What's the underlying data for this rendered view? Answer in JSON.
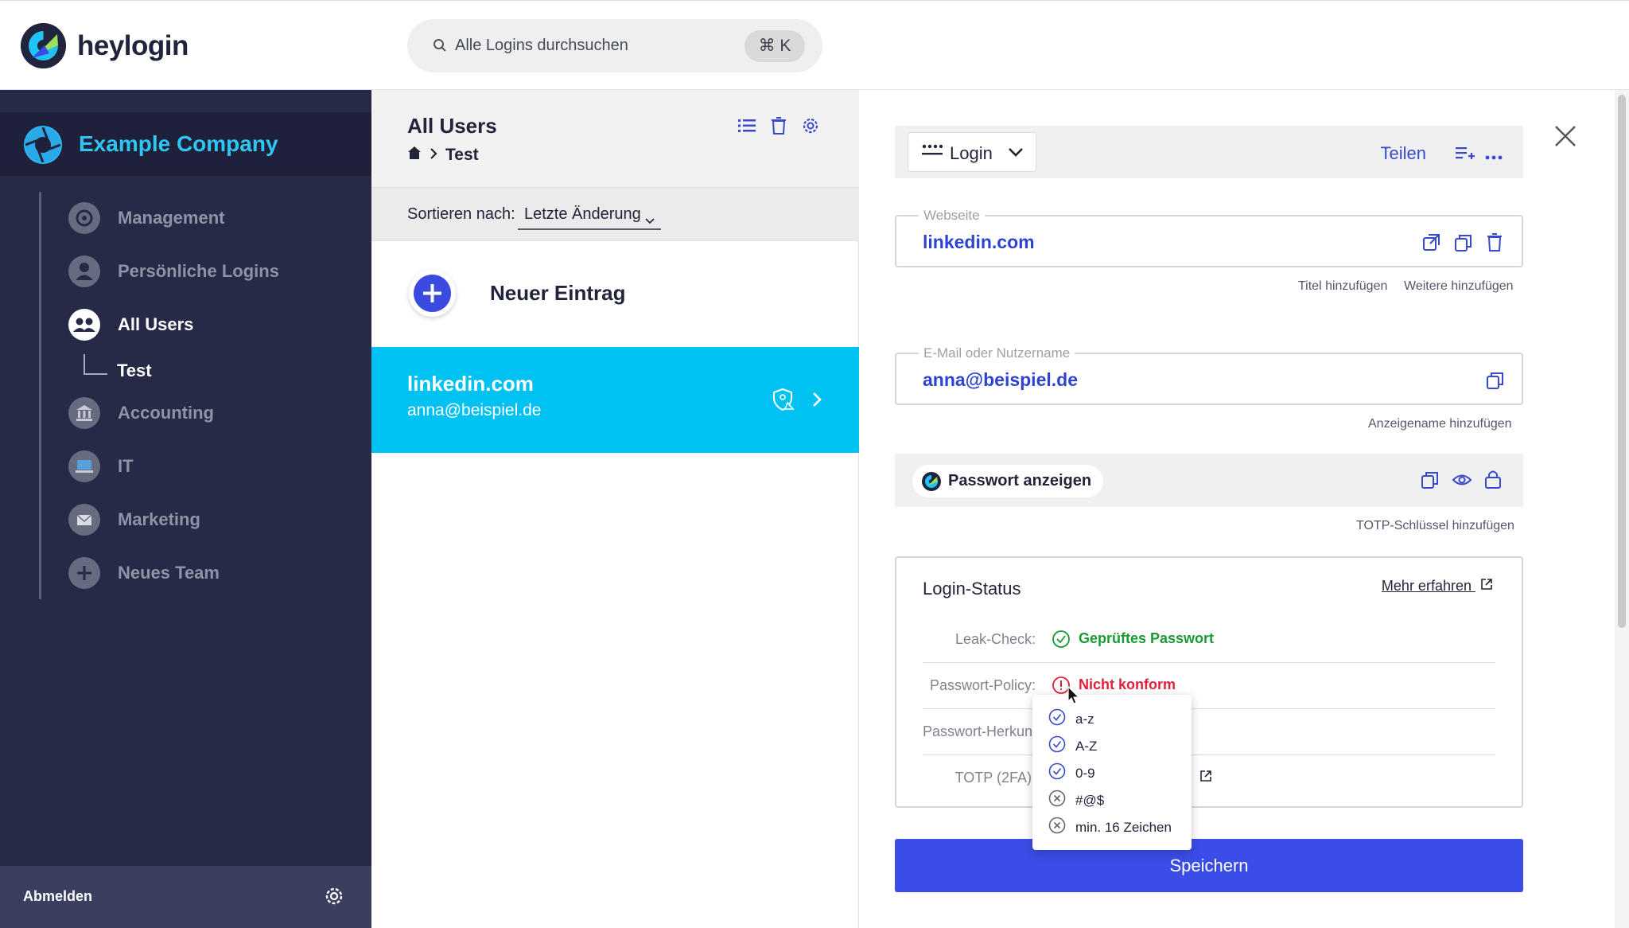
{
  "brand": {
    "name": "heylogin"
  },
  "search": {
    "placeholder": "Alle Logins durchsuchen",
    "shortcut": "⌘ K"
  },
  "sidebar": {
    "company": "Example Company",
    "items": [
      {
        "label": "Management",
        "icon": "gear-circle-icon"
      },
      {
        "label": "Persönliche Logins",
        "icon": "person-icon"
      },
      {
        "label": "All Users",
        "icon": "group-icon",
        "active": true
      },
      {
        "label": "Accounting",
        "icon": "bank-icon"
      },
      {
        "label": "IT",
        "icon": "laptop-icon"
      },
      {
        "label": "Marketing",
        "icon": "envelope-icon"
      },
      {
        "label": "Neues Team",
        "icon": "plus-icon"
      }
    ],
    "sub_item": "Test",
    "logout": "Abmelden"
  },
  "list": {
    "title": "All Users",
    "breadcrumb_current": "Test",
    "sort_label": "Sortieren nach:",
    "sort_value": "Letzte Änderung",
    "new_entry": "Neuer Eintrag",
    "entries": [
      {
        "title": "linkedin.com",
        "subtitle": "anna@beispiel.de"
      }
    ]
  },
  "detail": {
    "type": "Login",
    "share": "Teilen",
    "website": {
      "legend": "Webseite",
      "value": "linkedin.com"
    },
    "hints1": {
      "title": "Titel hinzufügen",
      "more": "Weitere hinzufügen"
    },
    "email": {
      "legend": "E-Mail oder Nutzername",
      "value": "anna@beispiel.de"
    },
    "display_name_hint": "Anzeigename hinzufügen",
    "password_button": "Passwort anzeigen",
    "totp_hint": "TOTP-Schlüssel hinzufügen",
    "status": {
      "title": "Login-Status",
      "learn_more": "Mehr erfahren",
      "rows": [
        {
          "label": "Leak-Check:",
          "value": "Geprüftes Passwort",
          "state": "ok"
        },
        {
          "label": "Passwort-Policy:",
          "value": "Nicht konform",
          "state": "error"
        },
        {
          "label": "Passwort-Herkunft:",
          "value": ""
        },
        {
          "label": "TOTP (2FA):",
          "value": ""
        }
      ]
    },
    "policy_checks": [
      {
        "label": "a-z",
        "ok": true
      },
      {
        "label": "A-Z",
        "ok": true
      },
      {
        "label": "0-9",
        "ok": true
      },
      {
        "label": "#@$",
        "ok": false
      },
      {
        "label": "min. 16 Zeichen",
        "ok": false
      }
    ],
    "save": "Speichern"
  },
  "colors": {
    "accent": "#3b4de8",
    "cyan": "#00c2f2",
    "sidebar": "#262a46",
    "ok": "#1a9a33",
    "error": "#e0203b"
  }
}
